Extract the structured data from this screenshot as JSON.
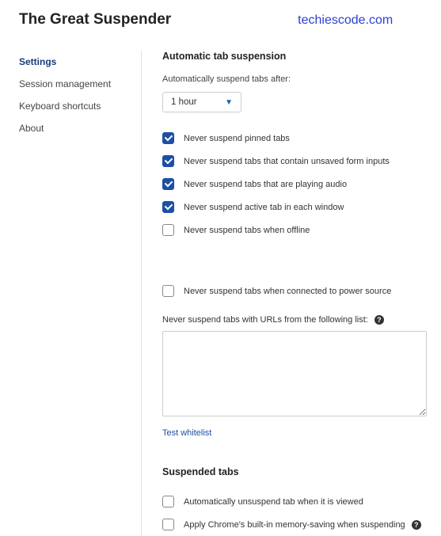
{
  "header": {
    "title": "The Great Suspender",
    "brand": "techiescode.com"
  },
  "sidebar": {
    "items": [
      {
        "label": "Settings",
        "active": true
      },
      {
        "label": "Session management",
        "active": false
      },
      {
        "label": "Keyboard shortcuts",
        "active": false
      },
      {
        "label": "About",
        "active": false
      }
    ]
  },
  "main": {
    "section1_title": "Automatic tab suspension",
    "suspend_after_label": "Automatically suspend tabs after:",
    "suspend_after_value": "1 hour",
    "options": [
      {
        "label": "Never suspend pinned tabs",
        "checked": true
      },
      {
        "label": "Never suspend tabs that contain unsaved form inputs",
        "checked": true
      },
      {
        "label": "Never suspend tabs that are playing audio",
        "checked": true
      },
      {
        "label": "Never suspend active tab in each window",
        "checked": true
      },
      {
        "label": "Never suspend tabs when offline",
        "checked": false
      }
    ],
    "power_option": {
      "label": "Never suspend tabs when connected to power source",
      "checked": false
    },
    "whitelist_label": "Never suspend tabs with URLs from the following list:",
    "whitelist_value": "",
    "test_whitelist": "Test whitelist",
    "section2_title": "Suspended tabs",
    "suspended_options": [
      {
        "label": "Automatically unsuspend tab when it is viewed",
        "checked": false
      },
      {
        "label": "Apply Chrome's built-in memory-saving when suspending",
        "checked": false,
        "help": true
      }
    ]
  }
}
